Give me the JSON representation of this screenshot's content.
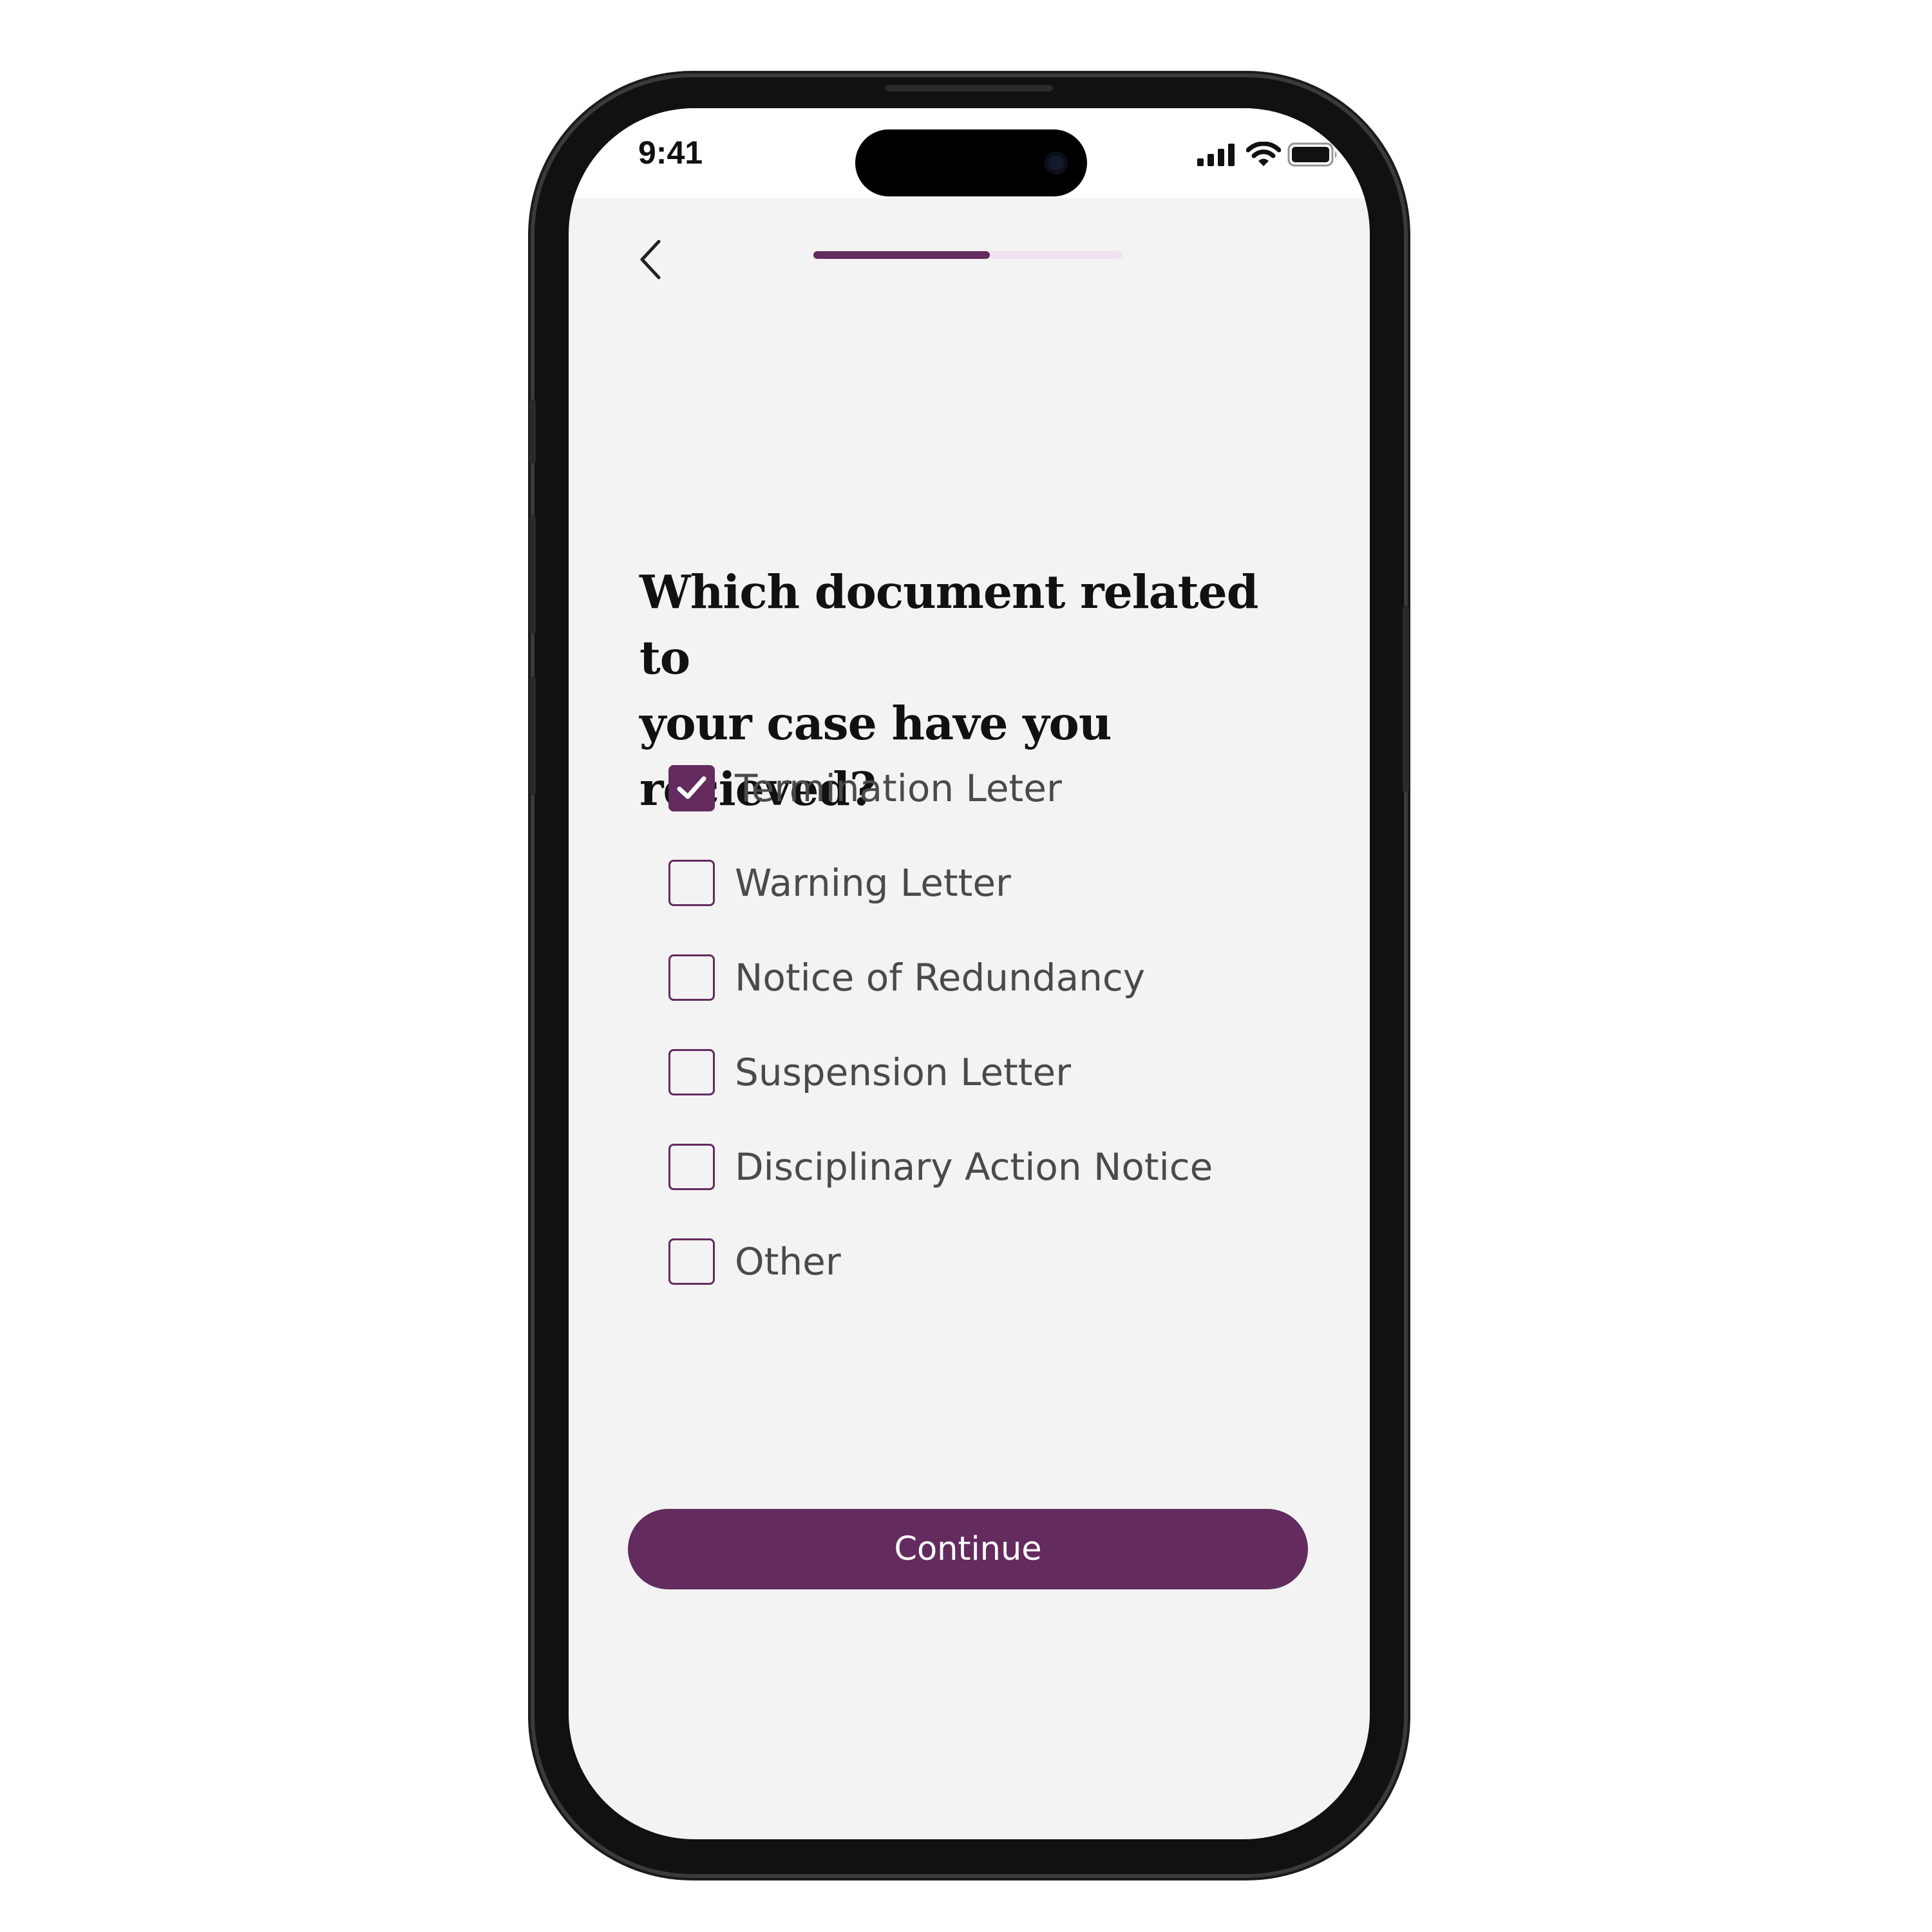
{
  "status_bar": {
    "time": "9:41"
  },
  "colors": {
    "accent": "#632b5e",
    "progress_track": "#f0e3ef",
    "screen_bg": "#f3f3f3"
  },
  "header": {
    "back_icon": "chevron-left-icon",
    "progress_fraction": 0.57
  },
  "question": {
    "line1": "Which document related to",
    "line2": "your case have you recieved?"
  },
  "options": [
    {
      "label": "Termination Leter",
      "checked": true
    },
    {
      "label": "Warning Letter",
      "checked": false
    },
    {
      "label": "Notice of Redundancy",
      "checked": false
    },
    {
      "label": "Suspension Letter",
      "checked": false
    },
    {
      "label": "Disciplinary Action Notice",
      "checked": false
    },
    {
      "label": "Other",
      "checked": false
    }
  ],
  "continue_button": {
    "label": "Continue"
  }
}
